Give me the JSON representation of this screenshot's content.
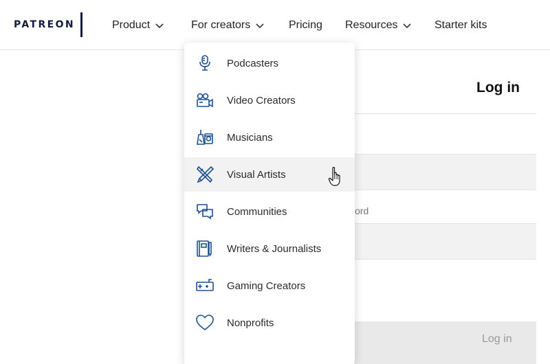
{
  "header": {
    "logo": "PATREON",
    "nav": [
      {
        "label": "Product",
        "has_dropdown": true
      },
      {
        "label": "For creators",
        "has_dropdown": true
      },
      {
        "label": "Pricing",
        "has_dropdown": false
      },
      {
        "label": "Resources",
        "has_dropdown": true
      },
      {
        "label": "Starter kits",
        "has_dropdown": false
      }
    ]
  },
  "login": {
    "title": "Log in",
    "partial_label": "ord",
    "button_label": "Log in"
  },
  "dropdown": {
    "items": [
      {
        "label": "Podcasters",
        "icon": "microphone-icon"
      },
      {
        "label": "Video Creators",
        "icon": "video-camera-icon"
      },
      {
        "label": "Musicians",
        "icon": "music-instruments-icon"
      },
      {
        "label": "Visual Artists",
        "icon": "brush-pencil-icon",
        "hovered": true
      },
      {
        "label": "Communities",
        "icon": "chat-bubbles-icon"
      },
      {
        "label": "Writers & Journalists",
        "icon": "notebook-pen-icon"
      },
      {
        "label": "Gaming Creators",
        "icon": "game-controller-icon"
      },
      {
        "label": "Nonprofits",
        "icon": "heart-icon"
      }
    ]
  },
  "colors": {
    "brand": "#141c3a",
    "icon_blue": "#1d4f91",
    "hover_bg": "#f2f2f2"
  }
}
